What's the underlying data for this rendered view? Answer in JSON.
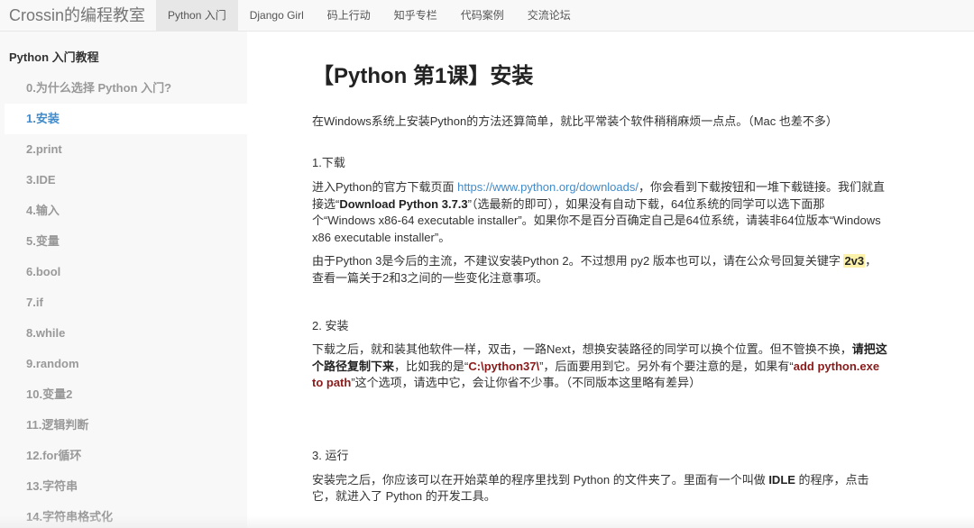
{
  "navbar": {
    "brand": "Crossin的编程教室",
    "items": [
      {
        "label": "Python 入门",
        "active": true
      },
      {
        "label": "Django Girl"
      },
      {
        "label": "码上行动"
      },
      {
        "label": "知乎专栏"
      },
      {
        "label": "代码案例"
      },
      {
        "label": "交流论坛"
      }
    ]
  },
  "sidebar": {
    "title": "Python 入门教程",
    "items": [
      "0.为什么选择 Python 入门?",
      "1.安装",
      "2.print",
      "3.IDE",
      "4.输入",
      "5.变量",
      "6.bool",
      "7.if",
      "8.while",
      "9.random",
      "10.变量2",
      "11.逻辑判断",
      "12.for循环",
      "13.字符串",
      "14.字符串格式化"
    ],
    "active_index": 1
  },
  "main": {
    "title": "【Python 第1课】安装",
    "intro": "在Windows系统上安装Python的方法还算简单，就比平常装个软件稍稍麻烦一点点。（Mac 也差不多）",
    "s1": {
      "head": "1.下载",
      "p1_a": "进入Python的官方下载页面 ",
      "p1_link": "https://www.python.org/downloads/",
      "p1_b": "，你会看到下载按钮和一堆下载链接。我们就直接选“",
      "p1_bold": "Download Python 3.7.3",
      "p1_c": "”（选最新的即可），如果没有自动下载，64位系统的同学可以选下面那个“Windows x86-64 executable installer”。如果你不是百分百确定自己是64位系统，请装非64位版本“Windows x86 executable installer”。",
      "p2_a": "由于Python 3是今后的主流，不建议安装Python 2。不过想用 py2 版本也可以，请在公众号回复关键字 ",
      "p2_hl": "2v3",
      "p2_b": "，查看一篇关于2和3之间的一些变化注意事项。"
    },
    "s2": {
      "head": "2. 安装",
      "a": "下载之后，就和装其他软件一样，双击，一路Next，想换安装路径的同学可以换个位置。但不管换不换，",
      "bold": "请把这个路径复制下来",
      "b": "，比如我的是“",
      "red1": "C:\\python37\\",
      "c": "”，后面要用到它。另外有个要注意的是，如果有“",
      "red2": "add python.exe to path",
      "d": "”这个选项，请选中它，会让你省不少事。（不同版本这里略有差异）"
    },
    "s3": {
      "head": "3. 运行",
      "a": "安装完之后，你应该可以在开始菜单的程序里找到 Python 的文件夹了。里面有一个叫做 ",
      "bold": "IDLE",
      "b": " 的程序，点击它，就进入了 Python 的开发工具。"
    }
  },
  "colors": {
    "link": "#428bca",
    "highlight": "#fbf1a9",
    "emphasis_red": "#8b1a1a",
    "sidebar_bg": "#f8f8f8"
  }
}
